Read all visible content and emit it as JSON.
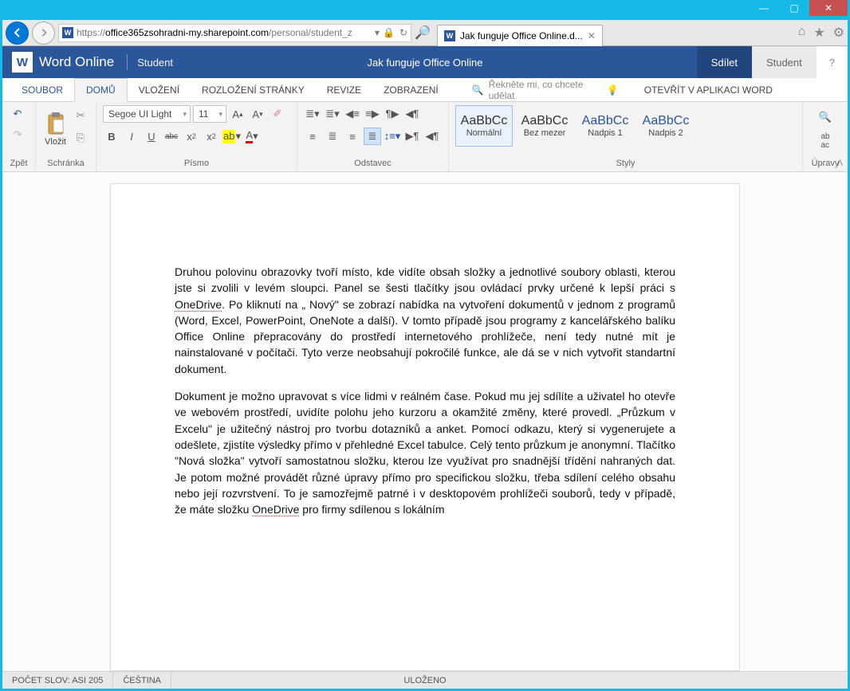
{
  "window": {
    "minimize": "—",
    "maximize": "▢",
    "close": "✕"
  },
  "ie": {
    "url_prefix": "https://",
    "url_host": "office365zsohradni-my.sharepoint.com",
    "url_path": "/personal/student_z",
    "tab_title": "Jak funguje Office Online.d...",
    "home_icon": "⌂",
    "star_icon": "★",
    "gear_icon": "⚙",
    "lock": "🔒",
    "refresh": "↻",
    "search": "🔎"
  },
  "header": {
    "app": "Word Online",
    "context": "Student",
    "doc_title": "Jak funguje Office Online",
    "share": "Sdílet",
    "user": "Student",
    "help": "?"
  },
  "tabs": {
    "file": "SOUBOR",
    "home": "DOMŮ",
    "insert": "VLOŽENÍ",
    "layout": "ROZLOŽENÍ STRÁNKY",
    "review": "REVIZE",
    "view": "ZOBRAZENÍ",
    "tell_me": "Řekněte mi, co chcete udělat",
    "open_desktop": "OTEVŘÍT V APLIKACI WORD"
  },
  "ribbon": {
    "undo_label": "Zpět",
    "clipboard": {
      "paste": "Vložit",
      "label": "Schránka"
    },
    "font": {
      "name": "Segoe UI Light",
      "size": "11",
      "label": "Písmo",
      "bold": "B",
      "italic": "I",
      "underline": "U",
      "strike": "abc"
    },
    "paragraph": {
      "label": "Odstavec"
    },
    "styles": {
      "label": "Styly",
      "items": [
        {
          "preview": "AaBbCc",
          "name": "Normální",
          "active": true,
          "heading": false
        },
        {
          "preview": "AaBbCc",
          "name": "Bez mezer",
          "active": false,
          "heading": false
        },
        {
          "preview": "AaBbCc",
          "name": "Nadpis 1",
          "active": false,
          "heading": true
        },
        {
          "preview": "AaBbCc",
          "name": "Nadpis 2",
          "active": false,
          "heading": true
        }
      ]
    },
    "editing": {
      "label": "Úpravy"
    }
  },
  "document": {
    "p1_a": "Druhou polovinu obrazovky tvoří místo, kde vidíte obsah složky a jednotlivé soubory oblasti, kterou jste si zvolili v levém sloupci. Panel se šesti tlačítky jsou ovládací prvky určené k lepší práci s ",
    "p1_link1": "OneDrive",
    "p1_b": ". Po kliknutí na „ Nový\" se zobrazí nabídka na ",
    "p1_bold1": "vytvoření dokumentů",
    "p1_c": " v jednom z programů (Word, Excel, PowerPoint, OneNote a další). V tomto případě jsou programy z kancelářského balíku ",
    "p1_bold2": "Office Online",
    "p1_d": " přepracovány do prostředí internetového prohlížeče, není tedy nutné mít je nainstalované v počítači. Tyto verze neobsahují pokročilé funkce, ale dá se v nich vytvořit standartní dokument.",
    "p2_a": "Dokument je možno upravovat s více lidmi v reálném čase. Pokud mu jej sdílíte a uživatel ho otevře ve webovém prostředí, uvidíte polohu jeho kurzoru a okamžité změny, které provedl. „",
    "p2_bold1": "Průzkum v Excelu",
    "p2_b": "\" je užitečný nástroj pro tvorbu dotazníků a anket. Pomocí odkazu, který si vygenerujete a odešlete, zjistíte výsledky přímo v přehledné Excel tabulce. Celý tento průzkum je anonymní. Tlačítko \"",
    "p2_bold2": "Nová složka",
    "p2_c": "\" vytvoří samostatnou složku, kterou lze využívat pro snadnější třídění nahraných dat. Je potom možné provádět různé úpravy přímo pro specifickou složku, třeba sdílení celého obsahu nebo její rozvrstvení. To je samozřejmě patrné i v desktopovém prohlížeči souborů, tedy v případě, že máte složku ",
    "p2_link1": "OneDrive",
    "p2_d": " pro firmy sdílenou s lokálním"
  },
  "status": {
    "words": "POČET SLOV: ASI 205",
    "lang": "ČEŠTINA",
    "saved": "ULOŽENO"
  }
}
